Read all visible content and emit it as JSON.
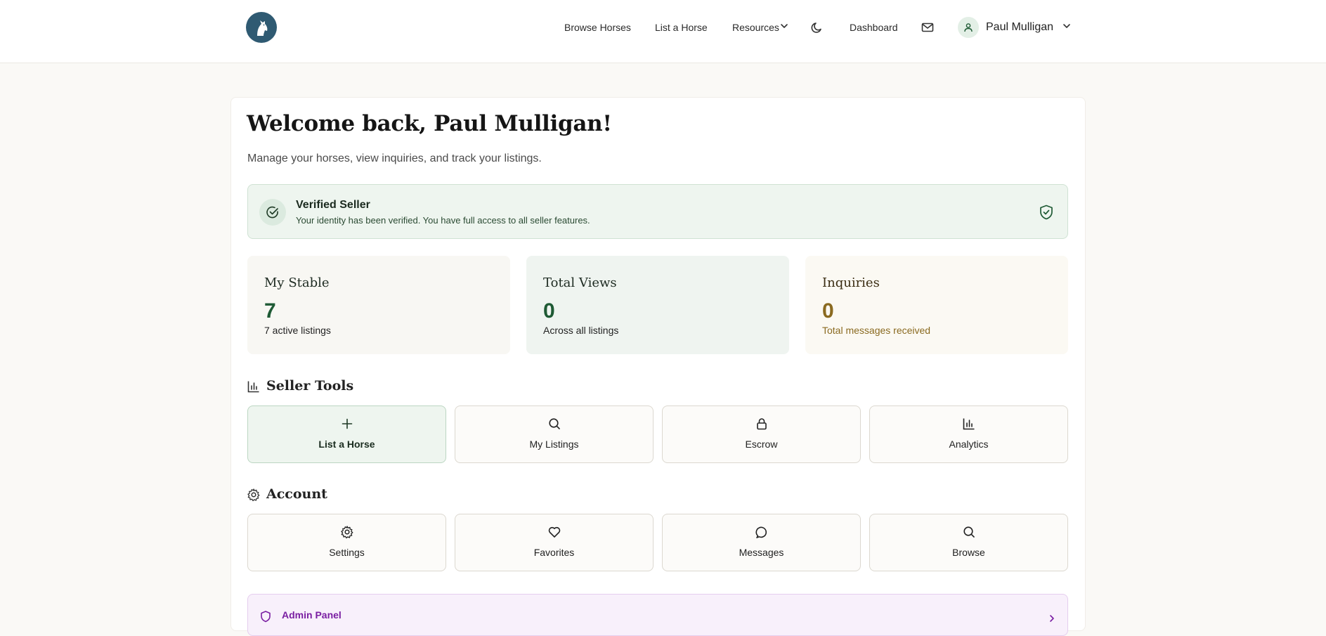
{
  "nav": {
    "links": [
      "Browse Horses",
      "List a Horse",
      "Resources",
      "Dashboard"
    ],
    "user_name": "Paul Mulligan"
  },
  "welcome": {
    "title": "Welcome back, Paul Mulligan!",
    "subtitle": "Manage your horses, view inquiries, and track your listings."
  },
  "verified": {
    "title": "Verified Seller",
    "description": "Your identity has been verified. You have full access to all seller features."
  },
  "stats": [
    {
      "title": "My Stable",
      "value": "7",
      "sub": "7 active listings"
    },
    {
      "title": "Total Views",
      "value": "0",
      "sub": "Across all listings"
    },
    {
      "title": "Inquiries",
      "value": "0",
      "sub": "Total messages received"
    }
  ],
  "seller_tools": {
    "title": "Seller Tools",
    "items": [
      "List a Horse",
      "My Listings",
      "Escrow",
      "Analytics"
    ]
  },
  "account": {
    "title": "Account",
    "items": [
      "Settings",
      "Favorites",
      "Messages",
      "Browse"
    ]
  },
  "admin": {
    "label": "Admin Panel"
  },
  "colors": {
    "brand_green": "#1e5a34",
    "inquiry_gold": "#8a6a20",
    "admin_purple": "#7a1fa2",
    "logo_blue": "#2f5a72"
  }
}
